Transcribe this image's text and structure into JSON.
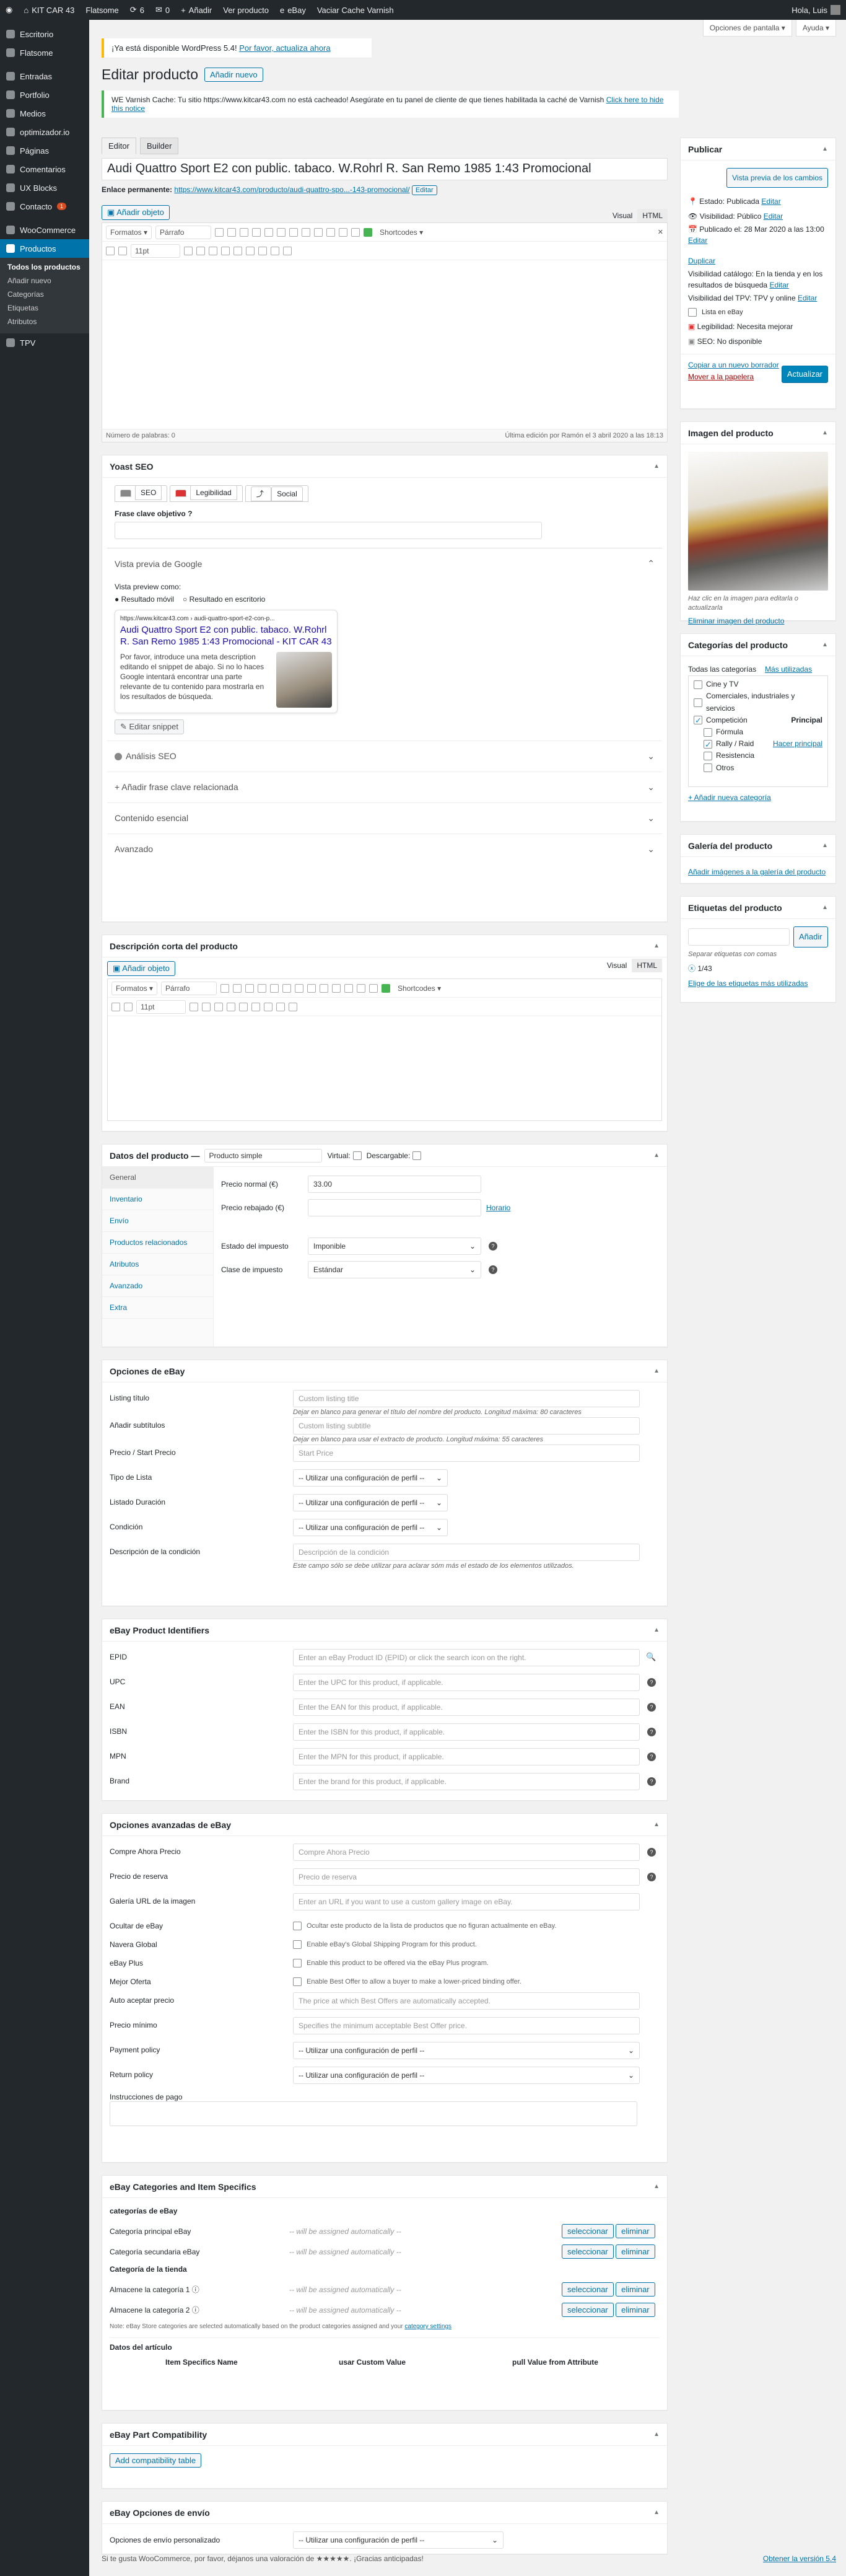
{
  "adminbar": {
    "site": "KIT CAR 43",
    "theme": "Flatsome",
    "updates": "6",
    "comments": "0",
    "add": "Añadir",
    "view": "Ver producto",
    "ebay": "eBay",
    "cache": "Vaciar Cache Varnish",
    "howdy": "Hola, Luis"
  },
  "topbuttons": {
    "screen": "Opciones de pantalla ▾",
    "help": "Ayuda ▾"
  },
  "sidebar": {
    "items": [
      {
        "label": "Escritorio"
      },
      {
        "label": "Flatsome"
      },
      {
        "label": "Entradas"
      },
      {
        "label": "Portfolio"
      },
      {
        "label": "Medios"
      },
      {
        "label": "optimizador.io"
      },
      {
        "label": "Páginas"
      },
      {
        "label": "Comentarios"
      },
      {
        "label": "UX Blocks"
      },
      {
        "label": "Contacto",
        "badge": "1"
      },
      {
        "label": "WooCommerce"
      },
      {
        "label": "Productos"
      }
    ],
    "sub": [
      "Todos los productos",
      "Añadir nuevo",
      "Categorías",
      "Etiquetas",
      "Atributos"
    ],
    "tpv": "TPV"
  },
  "notice": {
    "text": "¡Ya está disponible WordPress 5.4!",
    "link": "Por favor, actualiza ahora"
  },
  "header": {
    "title": "Editar producto",
    "add_new": "Añadir nuevo"
  },
  "varnish": {
    "text": "WE Varnish Cache: Tu sitio https://www.kitcar43.com no está cacheado! Asegúrate en tu panel de cliente de que tienes habilitada la caché de Varnish",
    "link": "Click here to hide this notice"
  },
  "editor_tabs": [
    "Editor",
    "Builder"
  ],
  "product_title": "Audi Quattro Sport E2 con public. tabaco. W.Rohrl R. San Remo 1985 1:43 Promocional",
  "permalink": {
    "label": "Enlace permanente:",
    "url": "https://www.kitcar43.com/producto/audi-quattro-spo...-143-promocional/",
    "edit": "Editar"
  },
  "media": {
    "add": "Añadir objeto",
    "visual": "Visual",
    "html": "HTML",
    "formats": "Formatos ▾",
    "paragraph": "Párrafo",
    "shortcodes": "Shortcodes ▾",
    "fontsize": "11pt"
  },
  "wordcount": {
    "left": "Número de palabras: 0",
    "right": "Última edición por Ramón el 3 abril 2020 a las 18:13"
  },
  "yoast": {
    "title": "Yoast SEO",
    "tabs": [
      "SEO",
      "Legibilidad",
      "Social"
    ],
    "focus": "Frase clave objetivo",
    "preview": "Vista previa de Google",
    "preview_as": "Vista preview como:",
    "mobile": "Resultado móvil",
    "desktop": "Resultado en escritorio",
    "url": "https://www.kitcar43.com › audi-quattro-sport-e2-con-p...",
    "snippet_title": "Audi Quattro Sport E2 con public. tabaco. W.Rohrl R. San Remo 1985 1:43 Promocional - KIT CAR 43",
    "snippet_desc": "Por favor, introduce una meta description editando el snippet de abajo. Si no lo haces Google intentará encontrar una parte relevante de tu contenido para mostrarla en los resultados de búsqueda.",
    "edit": "Editar snippet",
    "sections": [
      "Análisis SEO",
      "Añadir frase clave relacionada",
      "Contenido esencial",
      "Avanzado"
    ]
  },
  "short_desc": {
    "title": "Descripción corta del producto"
  },
  "product_data": {
    "title": "Datos del producto —",
    "type": "Producto simple",
    "virtual": "Virtual:",
    "download": "Descargable:",
    "tabs": [
      "General",
      "Inventario",
      "Envío",
      "Productos relacionados",
      "Atributos",
      "Avanzado",
      "Extra"
    ],
    "regular_label": "Precio normal (€)",
    "regular": "33.00",
    "sale_label": "Precio rebajado (€)",
    "schedule": "Horario",
    "tax_status_label": "Estado del impuesto",
    "tax_status": "Imponible",
    "tax_class_label": "Clase de impuesto",
    "tax_class": "Estándar"
  },
  "ebay_options": {
    "title": "Opciones de eBay",
    "rows": [
      {
        "label": "Listing título",
        "ph": "Custom listing title",
        "help": "Dejar en blanco para generar el título del nombre del producto. Longitud máxima: 80 caracteres"
      },
      {
        "label": "Añadir subtítulos",
        "ph": "Custom listing subtitle",
        "help": "Dejar en blanco para usar el extracto de producto. Longitud máxima: 55 caracteres"
      },
      {
        "label": "Precio / Start Precio",
        "ph": "Start Price",
        "help": ""
      },
      {
        "label": "Tipo de Lista",
        "ph": "-- Utilizar una configuración de perfil --",
        "help": ""
      },
      {
        "label": "Listado Duración",
        "ph": "-- Utilizar una configuración de perfil --",
        "help": ""
      },
      {
        "label": "Condición",
        "ph": "-- Utilizar una configuración de perfil --",
        "help": ""
      },
      {
        "label": "Descripción de la condición",
        "ph": "Descripción de la condición",
        "help": "Este campo sólo se debe utilizar para aclarar sóm más el estado de los elementos utilizados."
      }
    ]
  },
  "ebay_ids": {
    "title": "eBay Product Identifiers",
    "rows": [
      {
        "label": "EPID",
        "ph": "Enter an eBay Product ID (EPID) or click the search icon on the right."
      },
      {
        "label": "UPC",
        "ph": "Enter the UPC for this product, if applicable."
      },
      {
        "label": "EAN",
        "ph": "Enter the EAN for this product, if applicable."
      },
      {
        "label": "ISBN",
        "ph": "Enter the ISBN for this product, if applicable."
      },
      {
        "label": "MPN",
        "ph": "Enter the MPN for this product, if applicable."
      },
      {
        "label": "Brand",
        "ph": "Enter the brand for this product, if applicable."
      }
    ]
  },
  "ebay_adv": {
    "title": "Opciones avanzadas de eBay",
    "rows": [
      {
        "label": "Compre Ahora Precio",
        "ph": "Compre Ahora Precio",
        "kind": "field"
      },
      {
        "label": "Precio de reserva",
        "ph": "Precio de reserva",
        "kind": "field"
      },
      {
        "label": "Galería URL de la imagen",
        "ph": "Enter an URL if you want to use a custom gallery image on eBay.",
        "kind": "field"
      },
      {
        "label": "Ocultar de eBay",
        "ph": "Ocultar este producto de la lista de productos que no figuran actualmente en eBay.",
        "kind": "check"
      },
      {
        "label": "Navera Global",
        "ph": "Enable eBay's Global Shipping Program for this product.",
        "kind": "check"
      },
      {
        "label": "eBay Plus",
        "ph": "Enable this product to be offered via the eBay Plus program.",
        "kind": "check"
      },
      {
        "label": "Mejor Oferta",
        "ph": "Enable Best Offer to allow a buyer to make a lower-priced binding offer.",
        "kind": "check"
      },
      {
        "label": "Auto aceptar precio",
        "ph": "The price at which Best Offers are automatically accepted.",
        "kind": "field"
      },
      {
        "label": "Precio mínimo",
        "ph": "Specifies the minimum acceptable Best Offer price.",
        "kind": "field"
      },
      {
        "label": "Payment policy",
        "ph": "-- Utilizar una configuración de perfil --",
        "kind": "field"
      },
      {
        "label": "Return policy",
        "ph": "-- Utilizar una configuración de perfil --",
        "kind": "field"
      }
    ],
    "instructions": "Instrucciones de pago"
  },
  "ebay_cats": {
    "title": "eBay Categories and Item Specifics",
    "sub1": "categorías de eBay",
    "cat1": "Categoría principal eBay",
    "cat2": "Categoría secundaria eBay",
    "auto": "-- will be assigned automatically --",
    "sel": "seleccionar",
    "del": "eliminar",
    "sub2": "Categoría de la tienda",
    "store1": "Almacene la categoría 1",
    "store2": "Almacene la categoría 2",
    "note": "Note: eBay Store categories are selected automatically based on the product categories assigned and your",
    "note_link": "category settings",
    "item": "Datos del artículo",
    "cols": [
      "Item Specifics Name",
      "usar Custom Value",
      "pull Value from Attribute"
    ]
  },
  "ebay_compat": {
    "title": "eBay Part Compatibility",
    "add": "Add compatibility table"
  },
  "ebay_ship": {
    "title": "eBay Opciones de envío",
    "label": "Opciones de envío personalizado",
    "value": "-- Utilizar una configuración de perfil --"
  },
  "publish": {
    "title": "Publicar",
    "preview": "Vista previa de los cambios",
    "status": "Estado: Publicada",
    "status_edit": "Editar",
    "visibility": "Visibilidad: Público",
    "vis_edit": "Editar",
    "published": "Publicado el: 28 Mar 2020 a las 13:00",
    "pub_edit": "Editar",
    "duplicate": "Duplicar",
    "catalog": "Visibilidad catálogo: En la tienda y en los resultados de búsqueda",
    "cat_edit": "Editar",
    "tpv": "Visibilidad del TPV: TPV y online",
    "tpv_edit": "Editar",
    "ebay_list": "Lista en eBay",
    "legibility": "Legibilidad: Necesita mejorar",
    "seo": "SEO: No disponible",
    "copy": "Copiar a un nuevo borrador",
    "trash": "Mover a la papelera",
    "update": "Actualizar"
  },
  "product_image": {
    "title": "Imagen del producto",
    "hint": "Haz clic en la imagen para editarla o actualizarla",
    "remove": "Eliminar imagen del producto"
  },
  "categories": {
    "title": "Categorías del producto",
    "tab_all": "Todas las categorías",
    "tab_used": "Más utilizadas",
    "items": [
      {
        "l": "Cine y TV",
        "c": false,
        "d": 0
      },
      {
        "l": "Comerciales, industriales y servicios",
        "c": false,
        "d": 0
      },
      {
        "l": "Competición",
        "c": true,
        "d": 0
      },
      {
        "l": "Fórmula",
        "c": false,
        "d": 1
      },
      {
        "l": "Rally / Raid",
        "c": true,
        "d": 1
      },
      {
        "l": "Resistencia",
        "c": false,
        "d": 1
      },
      {
        "l": "Otros",
        "c": false,
        "d": 1
      }
    ],
    "primary": "Principal",
    "make_primary": "Hacer principal",
    "add": "+ Añadir nueva categoría"
  },
  "gallery": {
    "title": "Galería del producto",
    "add": "Añadir imágenes a la galería del producto"
  },
  "tags": {
    "title": "Etiquetas del producto",
    "add": "Añadir",
    "sep": "Separar etiquetas con comas",
    "tag": "1/43",
    "choose": "Elige de las etiquetas más utilizadas"
  },
  "footer": {
    "left": "Si te gusta WooCommerce, por favor, déjanos una valoración de ★★★★★. ¡Gracias anticipadas!",
    "right": "Obtener la versión 5.4"
  }
}
